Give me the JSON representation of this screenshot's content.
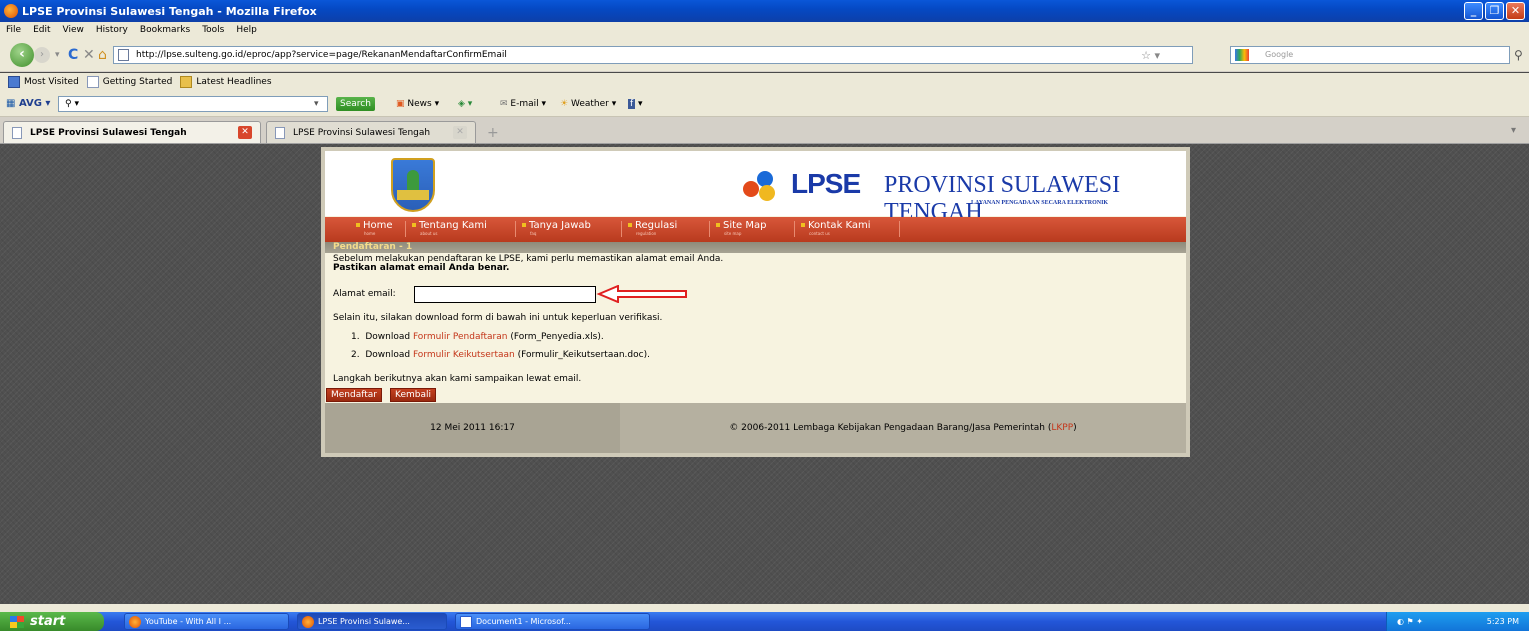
{
  "window": {
    "title": "LPSE Provinsi Sulawesi Tengah - Mozilla Firefox"
  },
  "menu": [
    "File",
    "Edit",
    "View",
    "History",
    "Bookmarks",
    "Tools",
    "Help"
  ],
  "nav": {
    "url": "http://lpse.sulteng.go.id/eproc/app?service=page/RekananMendaftarConfirmEmail",
    "search_placeholder": "Google"
  },
  "bookmarks": [
    "Most Visited",
    "Getting Started",
    "Latest Headlines"
  ],
  "avg": {
    "logo": "AVG",
    "search_label": "Search",
    "news": "News",
    "email": "E-mail",
    "weather": "Weather"
  },
  "tabs": [
    {
      "label": "LPSE Provinsi Sulawesi Tengah",
      "active": true
    },
    {
      "label": "LPSE Provinsi Sulawesi Tengah",
      "active": false
    }
  ],
  "site": {
    "logo": "LPSE",
    "province": "PROVINSI SULAWESI TENGAH",
    "tagline": "LAYANAN PENGADAAN SECARA ELEKTRONIK",
    "nav": [
      "Home",
      "Tentang Kami",
      "Tanya Jawab",
      "Regulasi",
      "Site Map",
      "Kontak Kami"
    ],
    "section_title": "Pendaftaran - 1",
    "intro": "Sebelum melakukan pendaftaran ke LPSE, kami perlu memastikan alamat email Anda.",
    "intro_bold": "Pastikan alamat email Anda benar.",
    "email_label": "Alamat email:",
    "email_value": "",
    "download_intro": "Selain itu, silakan download form di bawah ini untuk keperluan verifikasi.",
    "downloads": [
      {
        "num": "1.",
        "prefix": "Download",
        "link": "Formulir Pendaftaran",
        "file": "(Form_Penyedia.xls)."
      },
      {
        "num": "2.",
        "prefix": "Download",
        "link": "Formulir Keikutsertaan",
        "file": "(Formulir_Keikutsertaan.doc)."
      }
    ],
    "next_step": "Langkah berikutnya akan kami sampaikan lewat email.",
    "btn_register": "Mendaftar",
    "btn_back": "Kembali",
    "footer_date": "12 Mei 2011 16:17",
    "footer_copy": "© 2006-2011 Lembaga Kebijakan Pengadaan Barang/Jasa Pemerintah (",
    "footer_link": "LKPP",
    "footer_close": ")"
  },
  "taskbar": {
    "start": "start",
    "tasks": [
      "YouTube - With All I ...",
      "LPSE Provinsi Sulawe...",
      "Document1 - Microsof..."
    ],
    "clock": "5:23 PM"
  }
}
